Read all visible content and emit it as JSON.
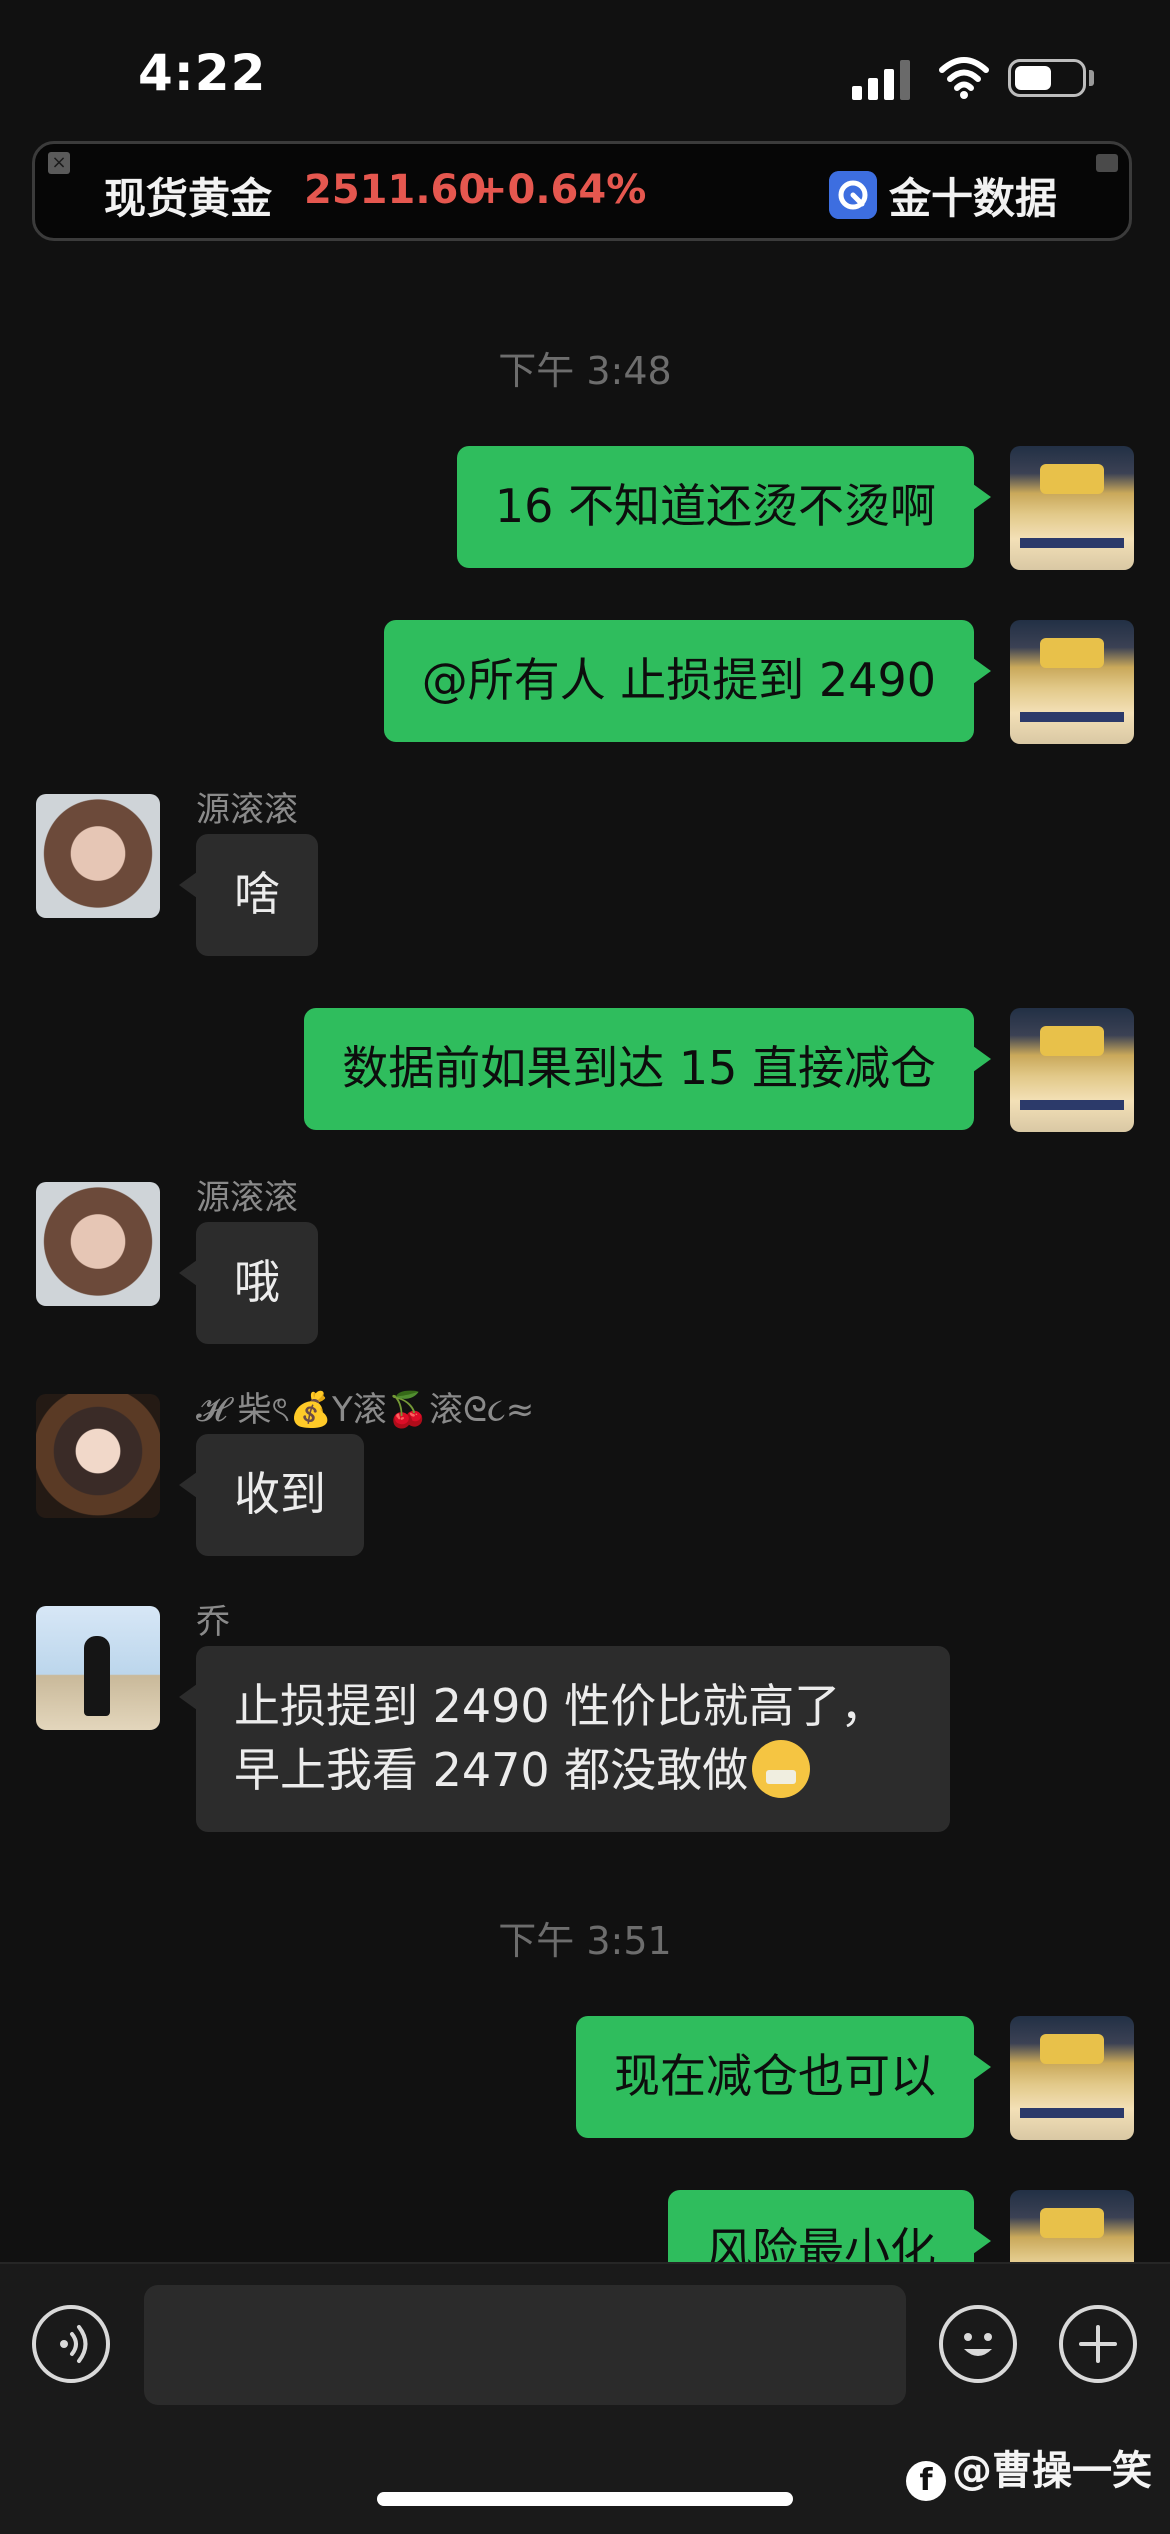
{
  "status": {
    "time": "4:22"
  },
  "ticker": {
    "name": "现货黄金",
    "price": "2511.60",
    "change": "+0.64%",
    "brand": "金十数据",
    "close_glyph": "×",
    "up_color": "#e5574f"
  },
  "chat": {
    "timestamps": [
      "下午 3:48",
      "下午 3:51"
    ],
    "messages": [
      {
        "side": "out",
        "text": "16 不知道还烫不烫啊"
      },
      {
        "side": "out",
        "text": "@所有人 止损提到 2490"
      },
      {
        "side": "in",
        "sender": "源滚滚",
        "text": "啥"
      },
      {
        "side": "out",
        "text": "数据前如果到达 15 直接减仓"
      },
      {
        "side": "in",
        "sender": "源滚滚",
        "text": "哦"
      },
      {
        "side": "in",
        "sender": "𝓗 柴ৎ💰Y滚🍒滚ᘓ૮≈",
        "text": "收到"
      },
      {
        "side": "in",
        "sender": "乔",
        "lines": [
          "止损提到 2490 性价比就高了，",
          "早上我看 2470 都没敢做"
        ],
        "emoji": "shushing-face-icon"
      },
      {
        "side": "out",
        "text": "现在减仓也可以"
      },
      {
        "side": "out",
        "text": "风险最小化"
      }
    ]
  },
  "input": {
    "placeholder": ""
  },
  "watermark": {
    "text": "@曹操一笑",
    "logo_glyph": "f"
  },
  "colors": {
    "outgoing_bubble": "#2fbd5d",
    "incoming_bubble": "#2c2c2c",
    "background": "#111111"
  }
}
